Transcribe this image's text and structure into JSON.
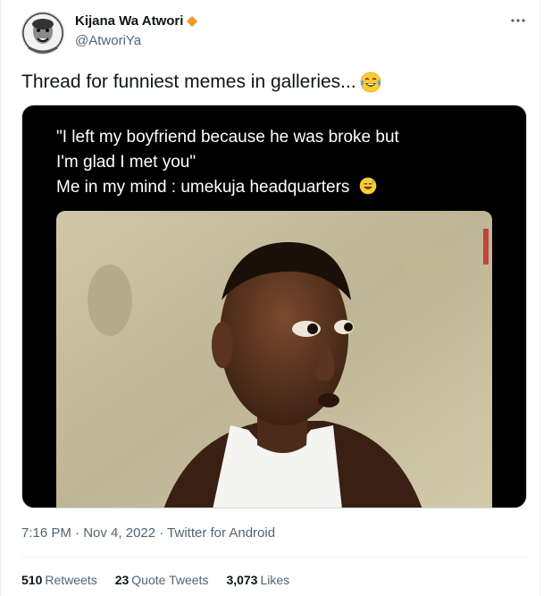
{
  "author": {
    "display_name": "Kijana Wa Atwori",
    "handle": "@AtworiYa"
  },
  "icons": {
    "verified": "verified-diamond-icon",
    "more": "more-options-icon",
    "emoji": "face-with-tears-of-joy-emoji",
    "verified_color": "#f7931e"
  },
  "tweet": {
    "text": "Thread for funniest memes in galleries..."
  },
  "media": {
    "caption_lines": [
      "\"I left my boyfriend because he was broke but",
      "I'm glad I met you\"",
      "Me in my mind : umekuja headquarters"
    ]
  },
  "meta": {
    "time": "7:16 PM",
    "separator": " · ",
    "date": "Nov 4, 2022",
    "source": "Twitter for Android"
  },
  "stats": {
    "retweets_count": "510",
    "retweets_label": "Retweets",
    "quote_count": "23",
    "quote_label": "Quote Tweets",
    "likes_count": "3,073",
    "likes_label": "Likes"
  }
}
